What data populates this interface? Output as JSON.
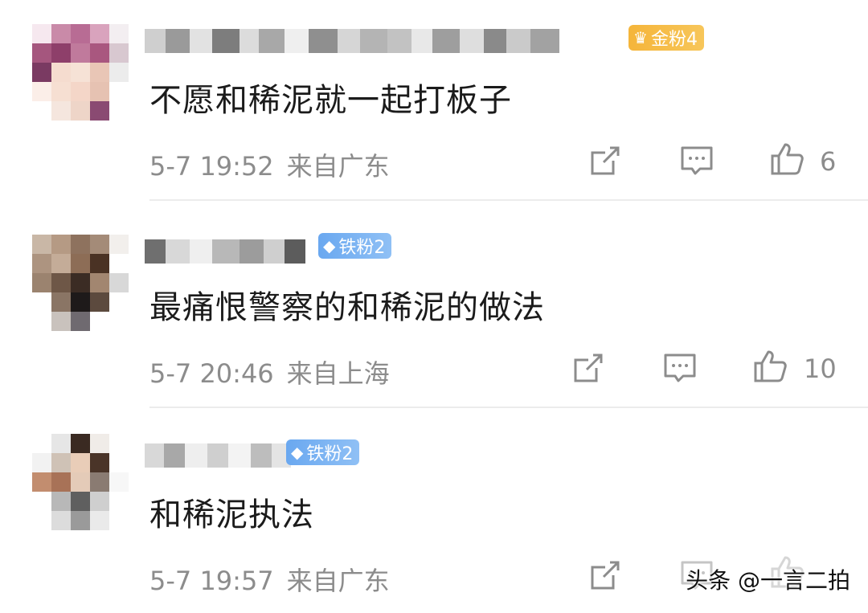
{
  "comments": [
    {
      "badge": "金粉4",
      "text": "不愿和稀泥就一起打板子",
      "time": "5-7 19:52",
      "location": "来自广东",
      "likes": "6"
    },
    {
      "badge": "铁粉2",
      "text": "最痛恨警察的和稀泥的做法",
      "time": "5-7 20:46",
      "location": "来自上海",
      "likes": "10"
    },
    {
      "badge": "铁粉2",
      "text": "和稀泥执法",
      "time": "5-7 19:57",
      "location": "来自广东",
      "likes": ""
    }
  ],
  "watermark": "头条 @一言二拍",
  "colors": {
    "gold_badge": "#f5b53a",
    "iron_badge": "#6aa8f0",
    "meta_gray": "#8c8c8c"
  },
  "icons": [
    "share-icon",
    "comment-icon",
    "like-icon",
    "crown-icon",
    "diamond-icon"
  ]
}
